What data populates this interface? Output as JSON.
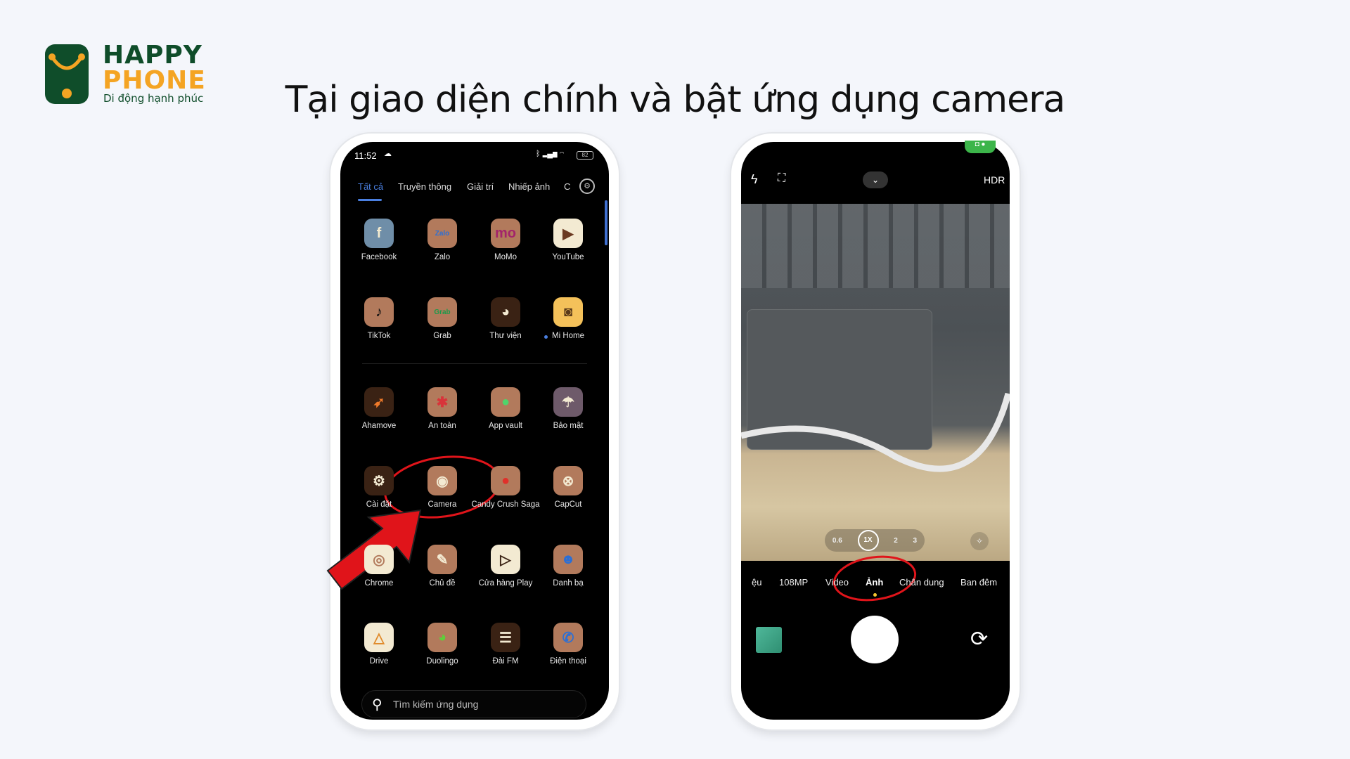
{
  "brand": {
    "line1": "HAPPY",
    "line2": "PHONE",
    "tagline": "Di động hạnh phúc"
  },
  "title": "Tại giao diện chính và bật ứng dụng camera",
  "left_phone": {
    "status_time": "11:52",
    "battery": "82",
    "tabs": [
      {
        "label": "Tất cả",
        "active": true
      },
      {
        "label": "Truyền thông"
      },
      {
        "label": "Giải trí"
      },
      {
        "label": "Nhiếp ảnh"
      },
      {
        "label": "C"
      }
    ],
    "apps": [
      {
        "label": "Facebook",
        "icon": "facebook-icon",
        "glyph": "f",
        "bg": "#6f8ea8",
        "fg": "#f5ecd0"
      },
      {
        "label": "Zalo",
        "icon": "zalo-icon",
        "glyph": "Zalo",
        "bg": "#b27a5c",
        "fg": "#2a6fd6"
      },
      {
        "label": "MoMo",
        "icon": "momo-icon",
        "glyph": "mo",
        "bg": "#b27a5c",
        "fg": "#a3246b"
      },
      {
        "label": "YouTube",
        "icon": "youtube-icon",
        "glyph": "▶",
        "bg": "#f3ead2",
        "fg": "#6b3a22"
      },
      {
        "label": "TikTok",
        "icon": "tiktok-icon",
        "glyph": "♪",
        "bg": "#b27a5c",
        "fg": "#111"
      },
      {
        "label": "Grab",
        "icon": "grab-icon",
        "glyph": "Grab",
        "bg": "#b27a5c",
        "fg": "#1c9a4a"
      },
      {
        "label": "Thư viện",
        "icon": "gallery-icon",
        "glyph": "◕",
        "bg": "#3a2214",
        "fg": "#f3ead2"
      },
      {
        "label": "Mi Home",
        "icon": "mi-home-icon",
        "glyph": "◙",
        "bg": "#f4c15a",
        "fg": "#5a3a1a",
        "dot": true
      },
      {
        "label": "Ahamove",
        "icon": "ahamove-icon",
        "glyph": "➶",
        "bg": "#3a2214",
        "fg": "#f07a2a"
      },
      {
        "label": "An toàn",
        "icon": "security-icon",
        "glyph": "✱",
        "bg": "#b27a5c",
        "fg": "#d8343a"
      },
      {
        "label": "App vault",
        "icon": "app-vault-icon",
        "glyph": "●",
        "bg": "#b27a5c",
        "fg": "#4fd46b"
      },
      {
        "label": "Bảo mật",
        "icon": "umbrella-icon",
        "glyph": "☂",
        "bg": "#6e5a6a",
        "fg": "#f3ead2"
      },
      {
        "label": "Cài đặt",
        "icon": "settings-icon",
        "glyph": "⚙",
        "bg": "#3a2214",
        "fg": "#f3ead2"
      },
      {
        "label": "Camera",
        "icon": "camera-icon",
        "glyph": "◉",
        "bg": "#b27a5c",
        "fg": "#f3ead2"
      },
      {
        "label": "Candy Crush Saga",
        "icon": "candy-crush-icon",
        "glyph": "●",
        "bg": "#b27a5c",
        "fg": "#e0302a"
      },
      {
        "label": "CapCut",
        "icon": "capcut-icon",
        "glyph": "⊗",
        "bg": "#b27a5c",
        "fg": "#f3ead2"
      },
      {
        "label": "Chrome",
        "icon": "chrome-icon",
        "glyph": "◎",
        "bg": "#f3ead2",
        "fg": "#b27a5c"
      },
      {
        "label": "Chủ đề",
        "icon": "theme-brush-icon",
        "glyph": "✎",
        "bg": "#b27a5c",
        "fg": "#f3ead2"
      },
      {
        "label": "Cửa hàng Play",
        "icon": "play-store-icon",
        "glyph": "▷",
        "bg": "#f3ead2",
        "fg": "#3a2214"
      },
      {
        "label": "Danh bạ",
        "icon": "contacts-icon",
        "glyph": "☻",
        "bg": "#b27a5c",
        "fg": "#2a6fd6"
      },
      {
        "label": "Drive",
        "icon": "drive-icon",
        "glyph": "△",
        "bg": "#f3ead2",
        "fg": "#e08a2a"
      },
      {
        "label": "Duolingo",
        "icon": "duolingo-icon",
        "glyph": "◕",
        "bg": "#b27a5c",
        "fg": "#5fce3a"
      },
      {
        "label": "Đài FM",
        "icon": "fm-radio-icon",
        "glyph": "☰",
        "bg": "#3a2214",
        "fg": "#f3ead2"
      },
      {
        "label": "Điện thoại",
        "icon": "phone-icon",
        "glyph": "✆",
        "bg": "#b27a5c",
        "fg": "#2a6fd6"
      }
    ],
    "search_placeholder": "Tìm kiếm ứng dụng"
  },
  "right_phone": {
    "hdr": "HDR",
    "zoom_levels": [
      {
        "label": "0.6"
      },
      {
        "label": "1X",
        "active": true
      },
      {
        "label": "2"
      },
      {
        "label": "3"
      }
    ],
    "modes": [
      {
        "label": "ệu"
      },
      {
        "label": "108MP"
      },
      {
        "label": "Video"
      },
      {
        "label": "Ảnh",
        "active": true
      },
      {
        "label": "Chân dung"
      },
      {
        "label": "Ban đêm"
      }
    ]
  },
  "colors": {
    "accent_tab": "#4a7fe0",
    "annotation": "#e0141a",
    "brand_green": "#0f4d2a",
    "brand_orange": "#f4a423"
  }
}
